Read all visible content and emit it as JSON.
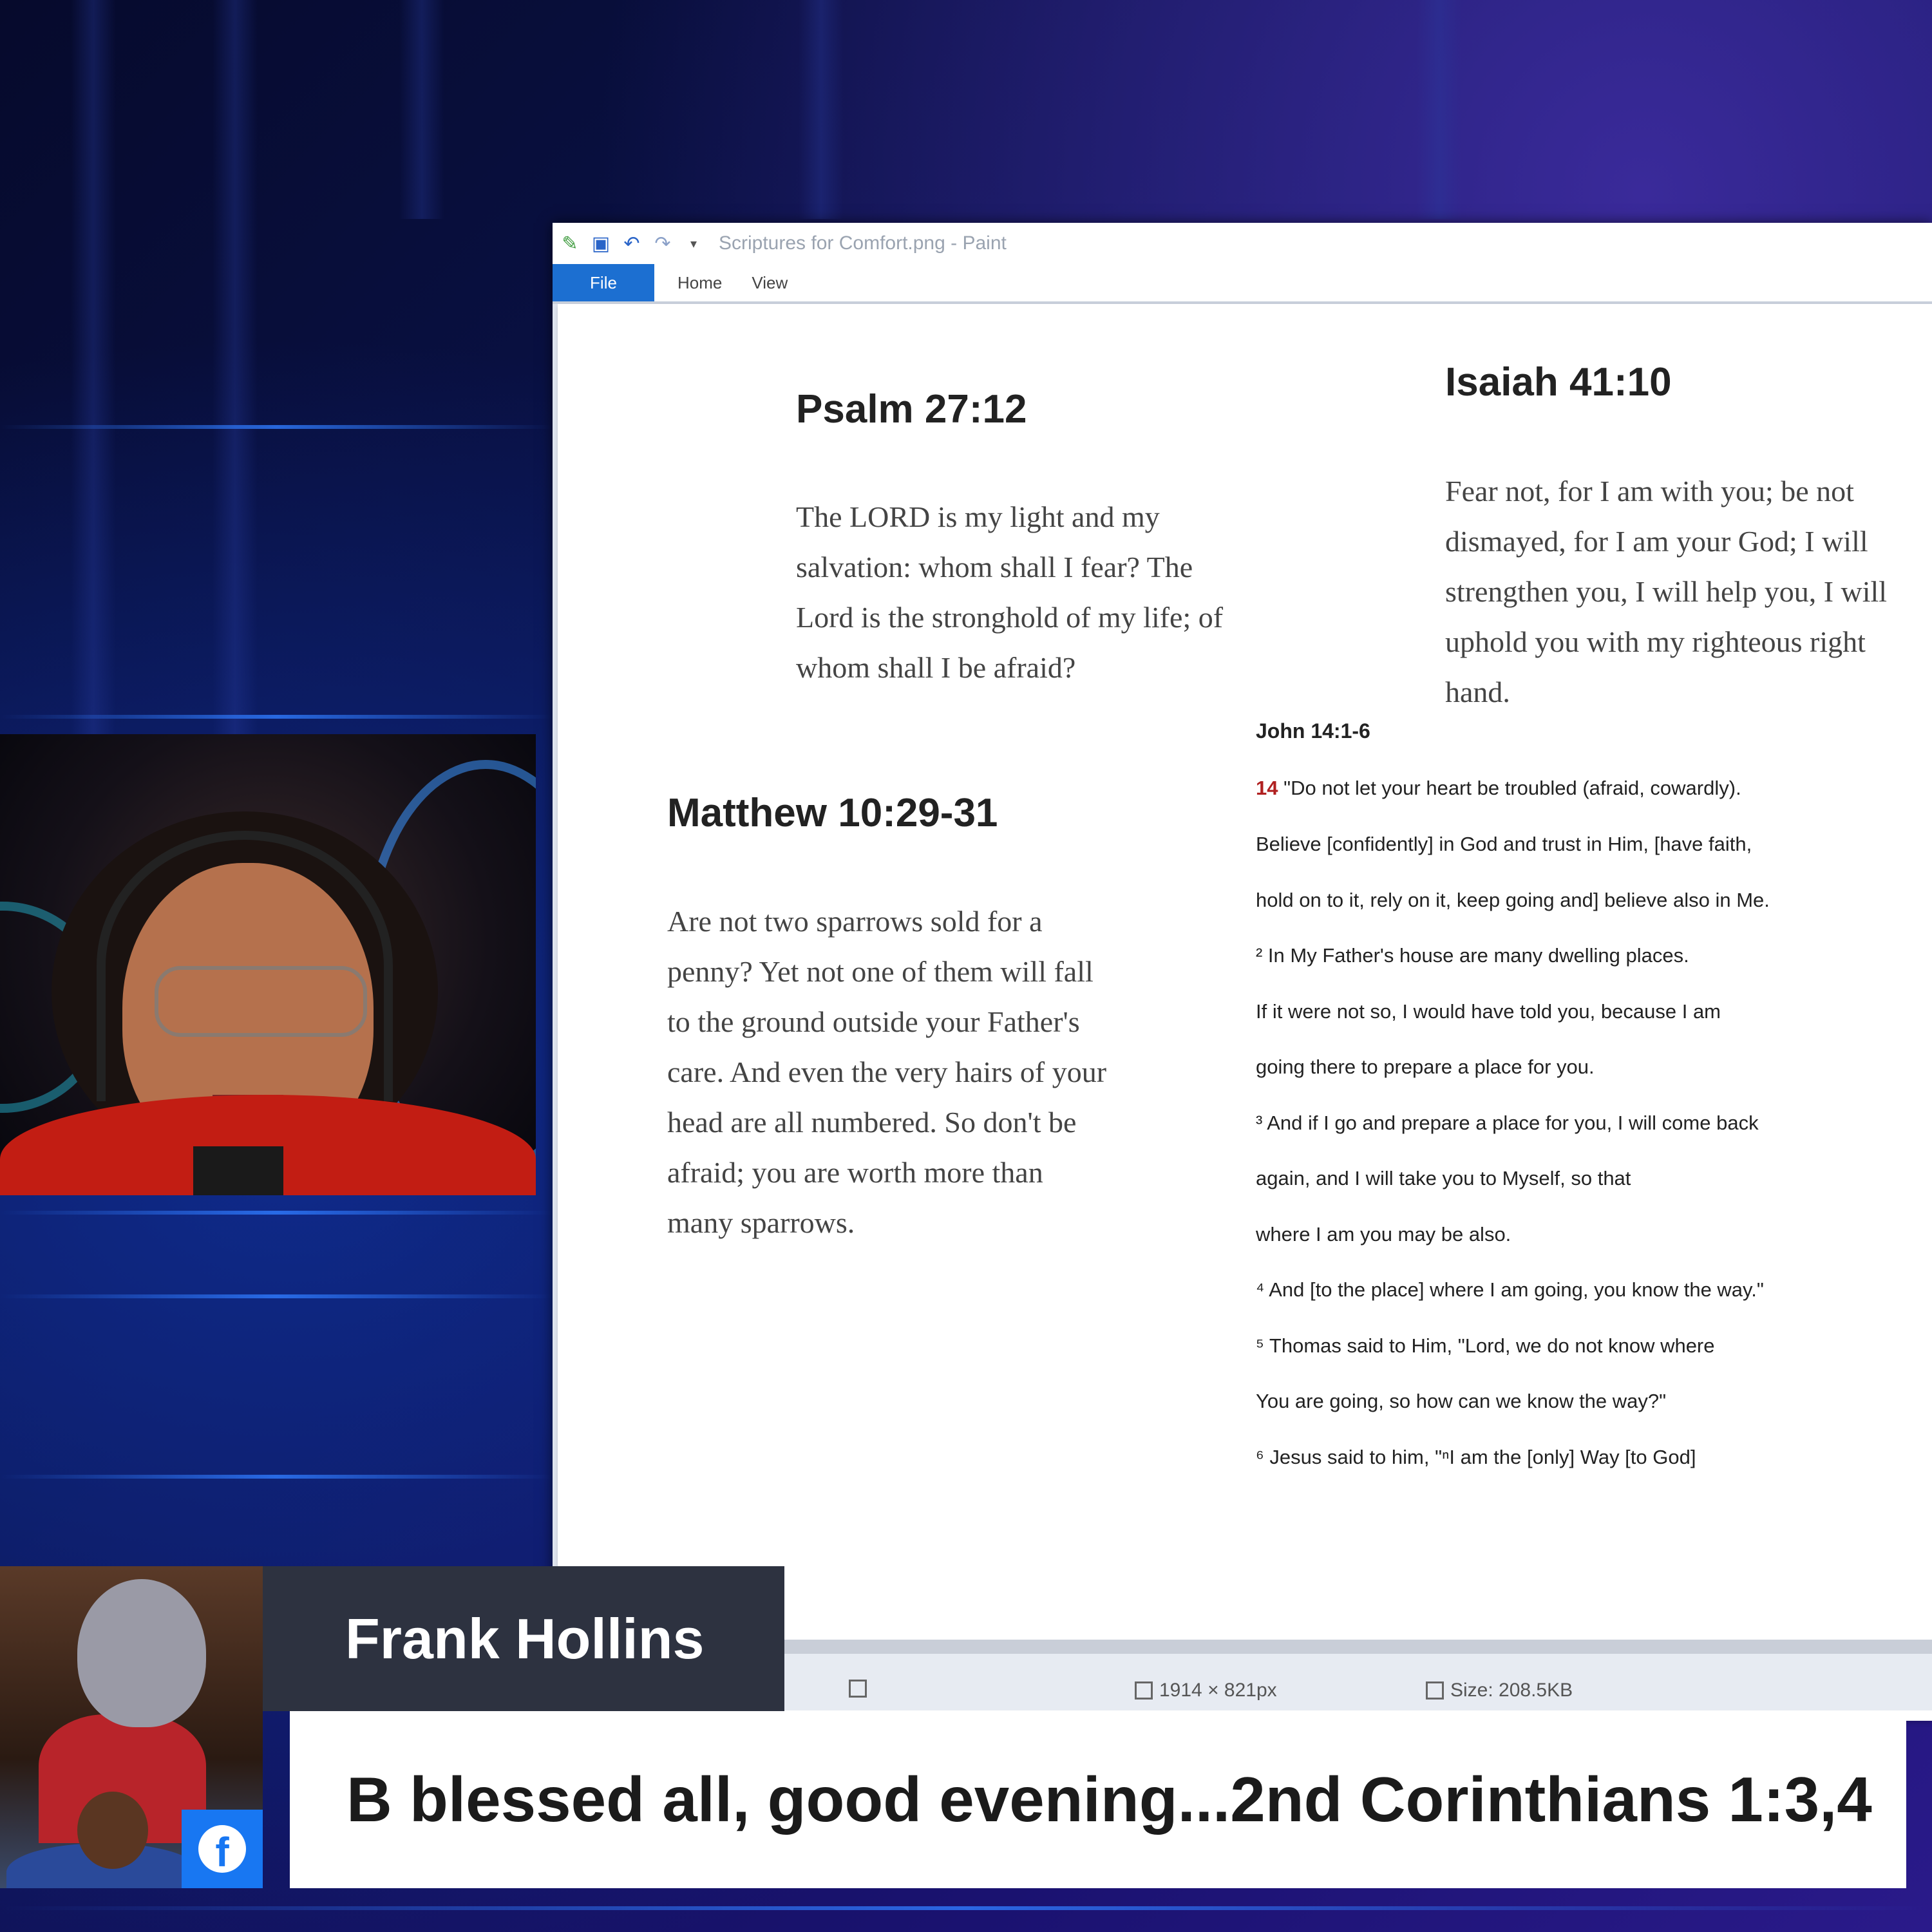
{
  "paint": {
    "title": "Scriptures for Comfort.png - Paint",
    "tabs": [
      "File",
      "Home",
      "View"
    ],
    "status": {
      "dimensions": "1914 × 821px",
      "size": "Size: 208.5KB"
    }
  },
  "scriptures": {
    "psalm": {
      "ref": "Psalm 27:12",
      "lines": [
        "The LORD is my light and my",
        "salvation: whom shall I fear? The",
        "Lord is the stronghold of my life; of",
        "whom shall I be afraid?"
      ]
    },
    "isaiah": {
      "ref": "Isaiah 41:10",
      "lines": [
        "Fear not, for I am with you; be not",
        "dismayed, for I am your God; I will",
        "strengthen you, I will help you, I will",
        "uphold you with my righteous right",
        "hand."
      ]
    },
    "matthew": {
      "ref": "Matthew 10:29-31",
      "lines": [
        "Are not two sparrows sold for a",
        "penny? Yet not one of them will fall",
        "to the ground outside your Father's",
        "care. And even the very hairs of your",
        "head are all numbered. So don't be",
        "afraid; you are worth more than",
        "many sparrows."
      ]
    },
    "john": {
      "ref": "John 14:1-6",
      "verse_num": "14",
      "lines": [
        "\"Do not let your heart be troubled (afraid, cowardly).",
        "Believe [confidently] in God and trust in Him, [have faith,",
        "hold on to it, rely on it, keep going and] believe also in Me.",
        "² In My Father's house are many dwelling places.",
        "If it were not so, I would have told you, because I am",
        "going there to prepare a place for you.",
        "³ And if I go and prepare a place for you, I will come back",
        "again, and I will take you to Myself, so that",
        "where I am you may be also.",
        "⁴ And [to the place] where I am going, you know the way.\"",
        "⁵ Thomas said to Him, \"Lord, we do not know where",
        "You are going, so how can we know the way?\"",
        "⁶ Jesus said to him, \"ⁿI am the [only] Way [to God]"
      ]
    }
  },
  "lower_third": {
    "name": "Frank Hollins",
    "comment": "B blessed all, good evening...2nd Corinthians 1:3,4",
    "platform_icon": "facebook-icon"
  }
}
